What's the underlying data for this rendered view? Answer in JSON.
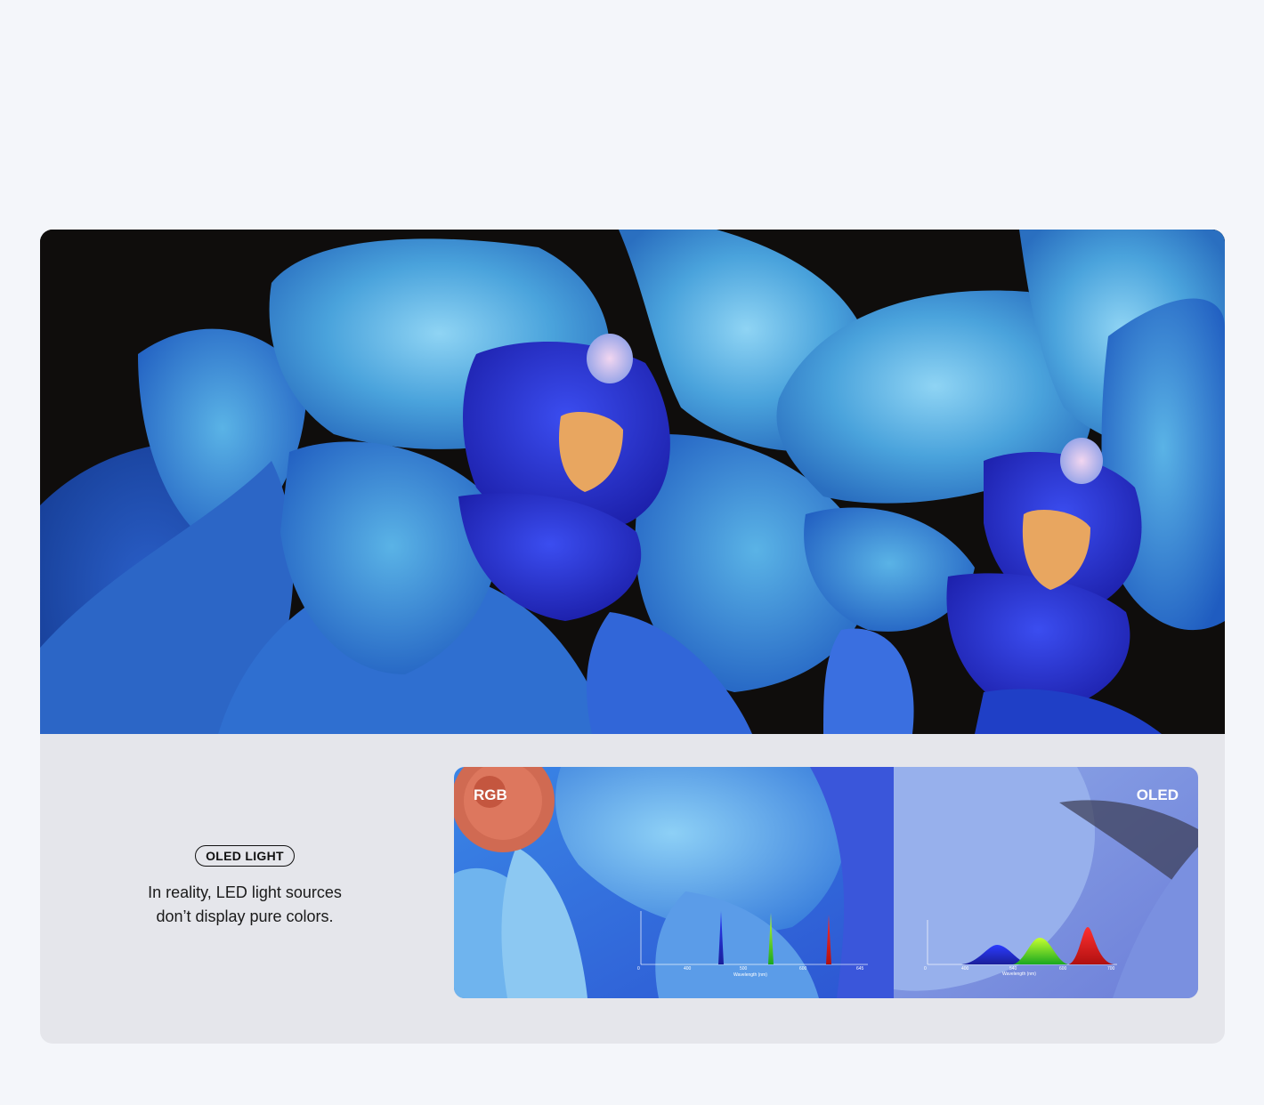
{
  "hero": {
    "icon": "orchid-photo"
  },
  "info": {
    "badge": "OLED LIGHT",
    "description_line1": "In reality, LED light sources",
    "description_line2": "don’t display pure colors."
  },
  "comparison": {
    "left_label": "RGB",
    "right_label": "OLED",
    "rgb_chart": {
      "ticks": [
        "0",
        "400",
        "500",
        "600",
        "645"
      ],
      "xlabel": "Wavelength (nm)"
    },
    "oled_chart": {
      "ticks": [
        "0",
        "400",
        "540",
        "600",
        "700"
      ],
      "xlabel": "Wavelength (nm)"
    }
  },
  "colors": {
    "page_bg": "#f4f6fa",
    "panel_bg": "#e5e6eb",
    "accent_blue": "#2f5fd8"
  }
}
